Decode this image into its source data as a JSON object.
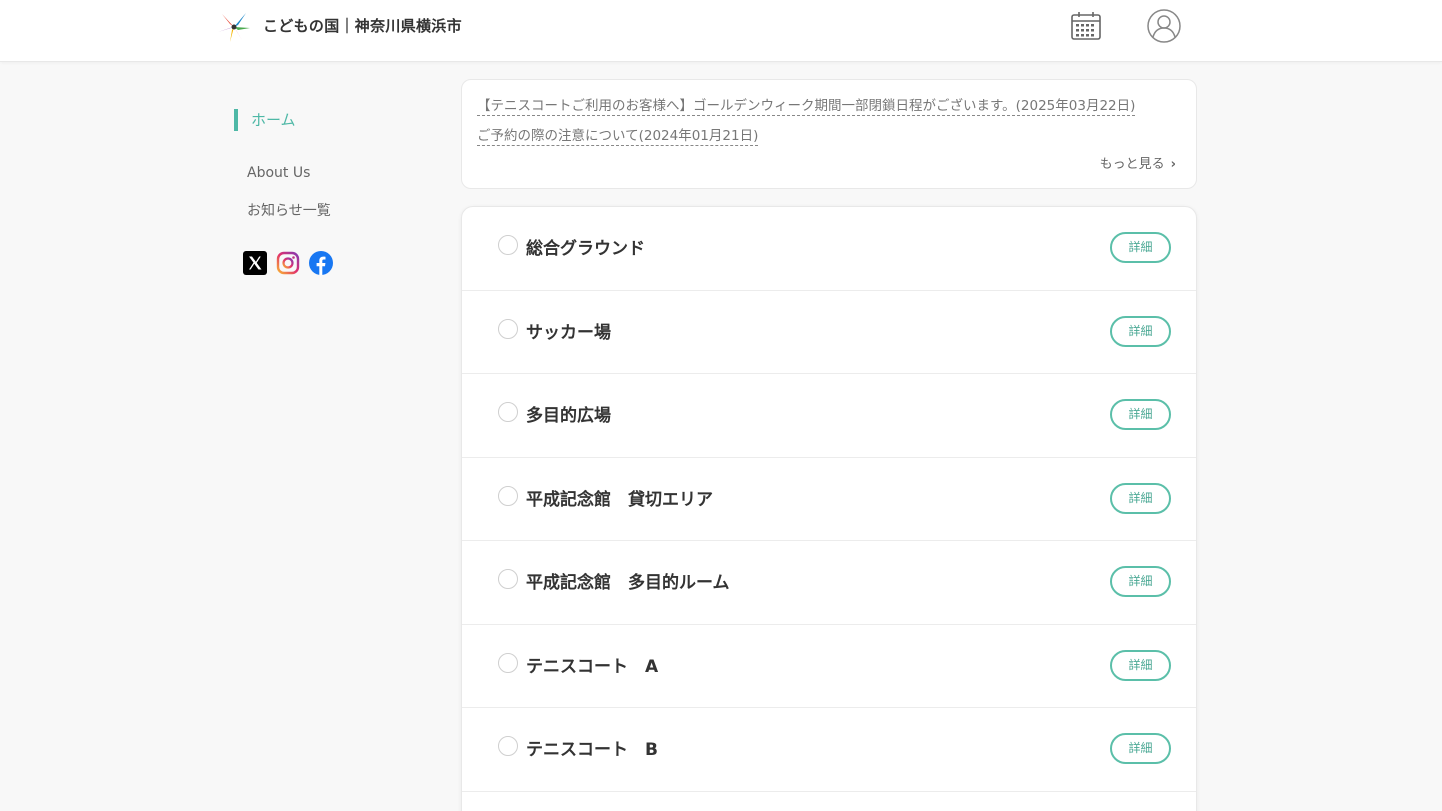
{
  "header": {
    "site_title": "こどもの国｜神奈川県横浜市",
    "logo_icon": "kodomonokuni-logo-icon",
    "calendar_icon": "calendar-icon",
    "user_icon": "user-account-icon"
  },
  "sidebar": {
    "home_label": "ホーム",
    "about_label": "About Us",
    "news_label": "お知らせ一覧",
    "social_icons": [
      "x-icon",
      "instagram-icon",
      "facebook-icon"
    ]
  },
  "notices": {
    "items": [
      {
        "text": "【テニスコートご利用のお客様へ】ゴールデンウィーク期間一部閉鎖日程がございます。(2025年03月22日)"
      },
      {
        "text": "ご予約の際の注意について(2024年01月21日)"
      }
    ],
    "more_label": "もっと見る"
  },
  "facilities": {
    "detail_label": "詳細",
    "items": [
      {
        "name": "総合グラウンド"
      },
      {
        "name": "サッカー場"
      },
      {
        "name": "多目的広場"
      },
      {
        "name": "平成記念館　貸切エリア"
      },
      {
        "name": "平成記念館　多目的ルーム"
      },
      {
        "name": "テニスコート　A"
      },
      {
        "name": "テニスコート　B"
      }
    ]
  },
  "colors": {
    "accent": "#4eb8a6",
    "detail_border": "#5bbfa9",
    "background": "#f8f8f8"
  }
}
